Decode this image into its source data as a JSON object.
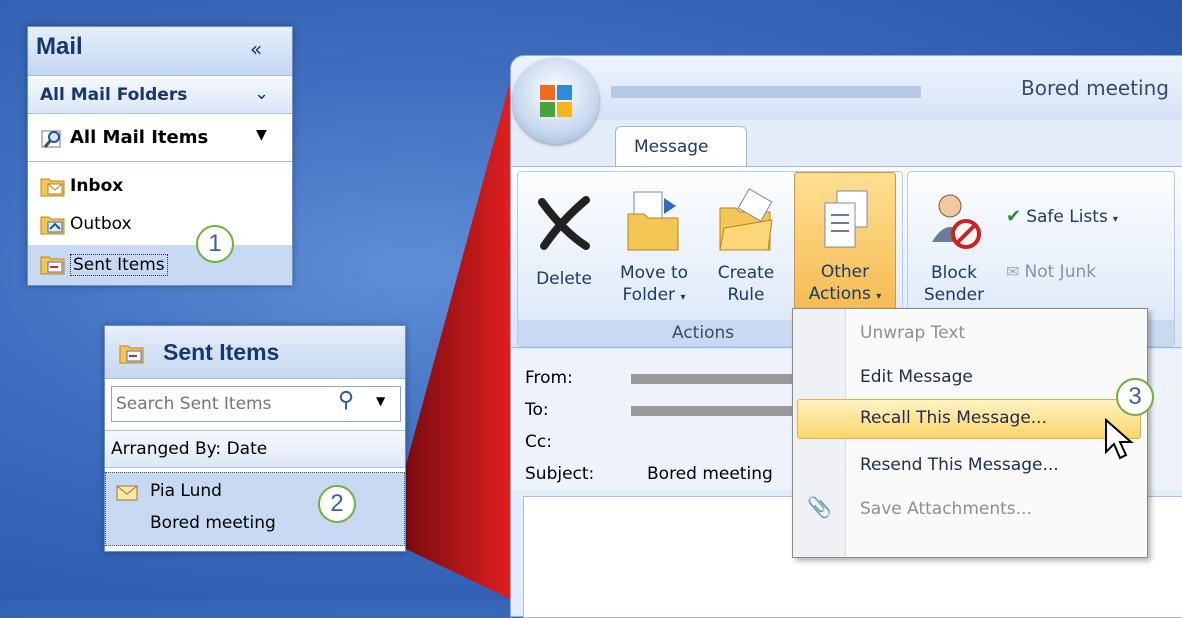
{
  "nav": {
    "title": "Mail",
    "all_folders": "All Mail Folders",
    "all_items": "All Mail Items",
    "folders": [
      {
        "label": "Inbox",
        "bold": true
      },
      {
        "label": "Outbox",
        "bold": false
      },
      {
        "label": "Sent Items",
        "bold": false
      }
    ]
  },
  "callouts": {
    "one": "1",
    "two": "2",
    "three": "3"
  },
  "sent": {
    "title": "Sent Items",
    "search_placeholder": "Search Sent Items",
    "arranged": "Arranged By: Date",
    "item_from": "Pia Lund",
    "item_subject": "Bored meeting"
  },
  "window": {
    "title": "Bored meeting",
    "tab": "Message",
    "group_label": "Actions",
    "buttons": {
      "delete": "Delete",
      "move1": "Move to",
      "move2": "Folder",
      "create1": "Create",
      "create2": "Rule",
      "other1": "Other",
      "other2": "Actions",
      "block1": "Block",
      "block2": "Sender",
      "safe_lists": "Safe Lists",
      "not_junk": "Not Junk"
    },
    "header": {
      "from": "From:",
      "to": "To:",
      "cc": "Cc:",
      "subject_label": "Subject:",
      "subject_value": "Bored meeting"
    }
  },
  "menu": {
    "unwrap": "Unwrap Text",
    "edit": "Edit Message",
    "recall": "Recall This Message...",
    "resend": "Resend This Message...",
    "save": "Save Attachments..."
  },
  "colors": {
    "accent_orange": "#f7c46b",
    "callout_green": "#6fb13a",
    "nav_blue": "#16376f"
  }
}
